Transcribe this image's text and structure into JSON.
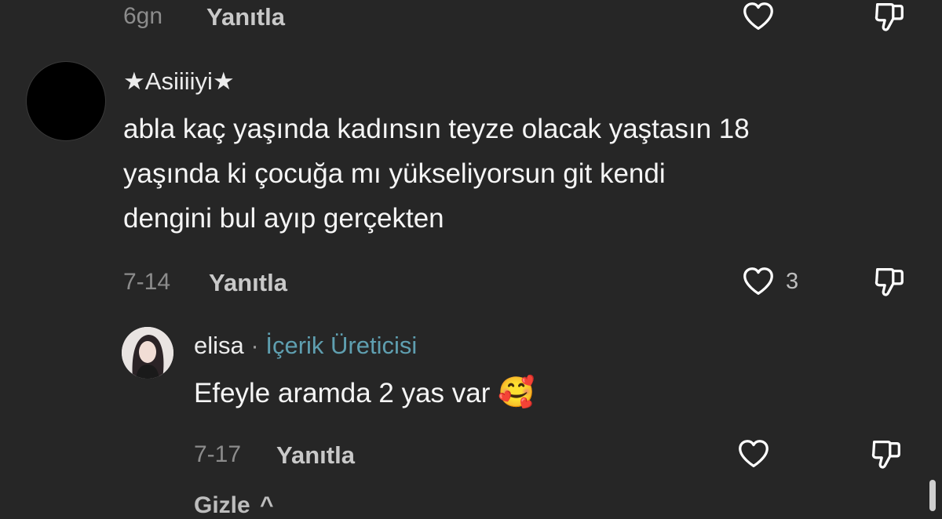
{
  "top_meta": {
    "time": "6gn",
    "reply_label": "Yanıtla"
  },
  "comment": {
    "username": "★Asiiiiyi★",
    "text_line1": "abla kaç yaşında kadınsın teyze olacak yaştasın 18",
    "text_line2": "yaşında ki çocuğa mı yükseliyorsun git kendi",
    "text_line3": "dengini bul ayıp gerçekten",
    "time": "7-14",
    "reply_label": "Yanıtla",
    "like_count": "3"
  },
  "reply": {
    "username": "elisa",
    "separator": "·",
    "badge": "İçerik Üreticisi",
    "text": "Efeyle aramda 2 yas var",
    "emoji": "🥰",
    "time": "7-17",
    "reply_label": "Yanıtla"
  },
  "footer": {
    "hide_label": "Gizle",
    "chevron": "^"
  },
  "colors": {
    "background": "#262626",
    "creator_badge": "#5f9fb0",
    "muted_text": "#8c8c8c"
  },
  "icons": [
    "heart-outline-icon",
    "dislike-icon",
    "avatar"
  ]
}
